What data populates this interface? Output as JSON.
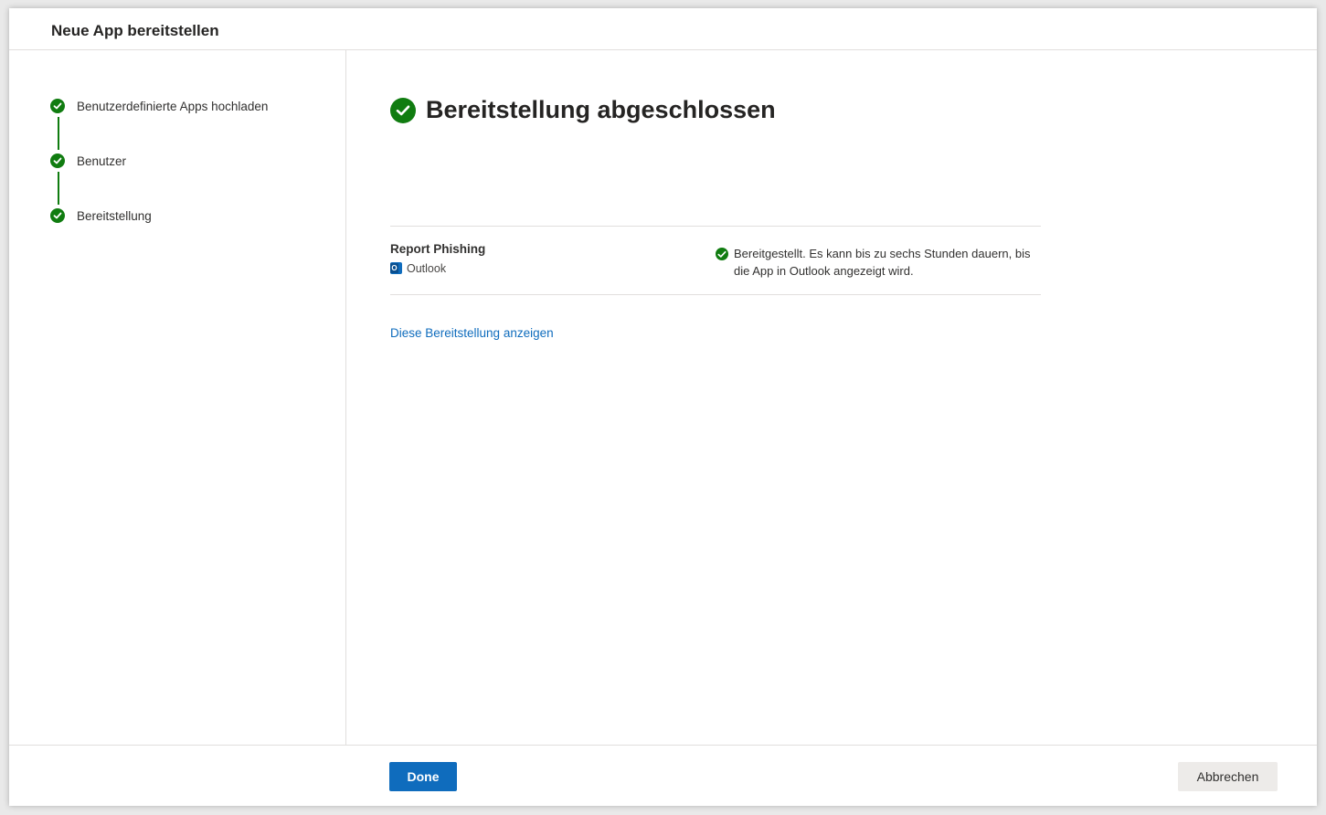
{
  "dialog": {
    "title": "Neue App bereitstellen"
  },
  "steps": [
    {
      "label": "Benutzerdefinierte Apps hochladen",
      "status": "complete"
    },
    {
      "label": "Benutzer",
      "status": "complete"
    },
    {
      "label": "Bereitstellung",
      "status": "complete"
    }
  ],
  "main": {
    "heading": "Bereitstellung abgeschlossen",
    "app": {
      "name": "Report Phishing",
      "host": "Outlook",
      "host_icon": "outlook-icon",
      "status_icon": "check-circle-icon",
      "status_text": "Bereitgestellt. Es kann bis zu sechs Stunden dauern, bis die App in Outlook angezeigt wird."
    },
    "view_link": "Diese Bereitstellung anzeigen"
  },
  "footer": {
    "done_label": "Done",
    "cancel_label": "Abbrechen"
  },
  "colors": {
    "success": "#107c10",
    "primary": "#0f6cbd",
    "link": "#0f6cbd"
  }
}
